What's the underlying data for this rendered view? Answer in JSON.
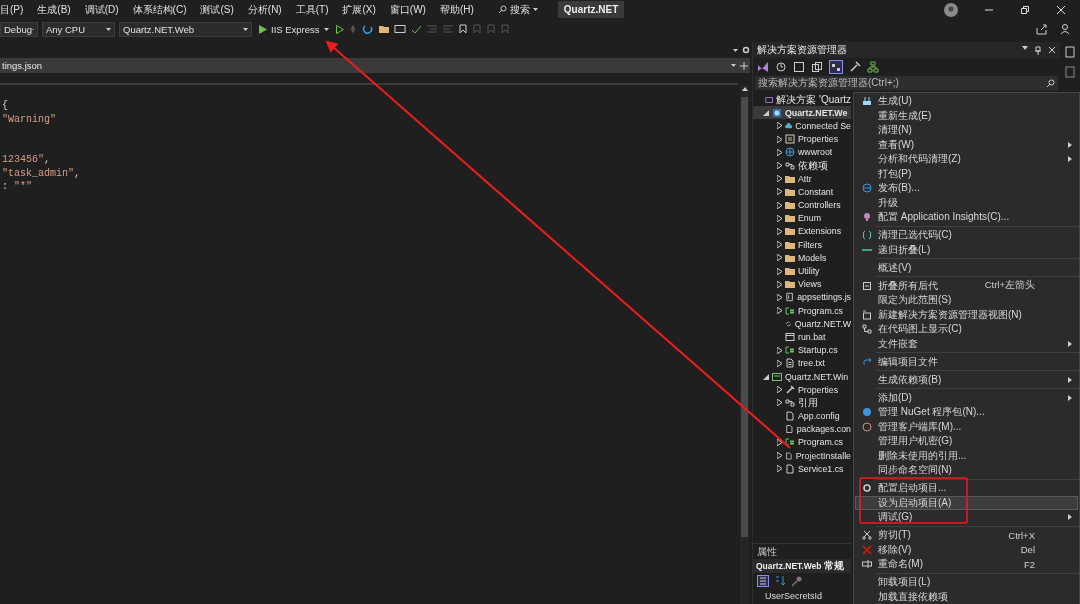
{
  "menu_bar": {
    "items": [
      "目(P)",
      "生成(B)",
      "调试(D)",
      "体系结构(C)",
      "测试(S)",
      "分析(N)",
      "工具(T)",
      "扩展(X)",
      "窗口(W)",
      "帮助(H)"
    ],
    "search": "搜索",
    "solution_name": "Quartz.NET"
  },
  "toolbar": {
    "configuration": "Debug",
    "platform": "Any CPU",
    "startup_project": "Quartz.NET.Web",
    "run_target": "IIS Express"
  },
  "editor": {
    "tab": {
      "title": "tings.json"
    },
    "lines": [
      {
        "kind": "code",
        "tokens": [
          {
            "kind": "punct",
            "text": "{"
          }
        ]
      },
      {
        "kind": "code",
        "tokens": [
          {
            "kind": "string",
            "text": "\"Warning\""
          }
        ]
      },
      {
        "kind": "blank"
      },
      {
        "kind": "blank"
      },
      {
        "kind": "code",
        "tokens": [
          {
            "kind": "string",
            "text": "123456\""
          },
          {
            "kind": "punct",
            "text": ","
          }
        ]
      },
      {
        "kind": "code",
        "tokens": [
          {
            "kind": "string",
            "text": "\"task_admin\""
          },
          {
            "kind": "punct",
            "text": ","
          }
        ]
      },
      {
        "kind": "code",
        "tokens": [
          {
            "kind": "punct",
            "text": ": "
          },
          {
            "kind": "string",
            "text": "\"*\""
          }
        ]
      }
    ]
  },
  "solution_explorer": {
    "title": "解决方案资源管理器",
    "search": {
      "placeholder": "搜索解决方案资源管理器(Ctrl+;)"
    },
    "tree": [
      {
        "label": "解决方案 'Quartz",
        "kind": "solution",
        "leaf": true,
        "selected": false,
        "children": [
          {
            "label": "Quartz.NET.We",
            "kind": "web-project",
            "leaf": false,
            "expanded": true,
            "selected": true,
            "children": [
              {
                "label": "Connected Se",
                "kind": "cloud",
                "leaf": false,
                "expanded": false,
                "selected": false
              },
              {
                "label": "Properties",
                "kind": "properties",
                "leaf": false,
                "expanded": false,
                "selected": false
              },
              {
                "label": "wwwroot",
                "kind": "globe",
                "leaf": false,
                "expanded": false,
                "selected": false
              },
              {
                "label": "依赖项",
                "kind": "dependencies",
                "leaf": false,
                "expanded": false,
                "selected": false
              },
              {
                "label": "Attr",
                "kind": "folder",
                "leaf": false,
                "expanded": false,
                "selected": false
              },
              {
                "label": "Constant",
                "kind": "folder",
                "leaf": false,
                "expanded": false,
                "selected": false
              },
              {
                "label": "Controllers",
                "kind": "folder",
                "leaf": false,
                "expanded": false,
                "selected": false
              },
              {
                "label": "Enum",
                "kind": "folder",
                "leaf": false,
                "expanded": false,
                "selected": false
              },
              {
                "label": "Extensions",
                "kind": "folder",
                "leaf": false,
                "expanded": false,
                "selected": false
              },
              {
                "label": "Filters",
                "kind": "folder",
                "leaf": false,
                "expanded": false,
                "selected": false
              },
              {
                "label": "Models",
                "kind": "folder",
                "leaf": false,
                "expanded": false,
                "selected": false
              },
              {
                "label": "Utility",
                "kind": "folder",
                "leaf": false,
                "expanded": false,
                "selected": false
              },
              {
                "label": "Views",
                "kind": "folder",
                "leaf": false,
                "expanded": false,
                "selected": false
              },
              {
                "label": "appsettings.js",
                "kind": "json",
                "leaf": false,
                "expanded": false,
                "selected": false
              },
              {
                "label": "Program.cs",
                "kind": "csharp",
                "leaf": false,
                "expanded": false,
                "selected": false
              },
              {
                "label": "Quartz.NET.W",
                "kind": "sync",
                "leaf": true,
                "selected": false
              },
              {
                "label": "run.bat",
                "kind": "batch",
                "leaf": true,
                "selected": false
              },
              {
                "label": "Startup.cs",
                "kind": "csharp",
                "leaf": false,
                "expanded": false,
                "selected": false
              },
              {
                "label": "tree.txt",
                "kind": "text",
                "leaf": false,
                "expanded": false,
                "selected": false
              }
            ]
          },
          {
            "label": "Quartz.NET.Win",
            "kind": "win-project",
            "leaf": false,
            "expanded": true,
            "selected": false,
            "children": [
              {
                "label": "Properties",
                "kind": "wrench",
                "leaf": false,
                "expanded": false,
                "selected": false
              },
              {
                "label": "引用",
                "kind": "dependencies",
                "leaf": false,
                "expanded": false,
                "selected": false
              },
              {
                "label": "App.config",
                "kind": "config",
                "leaf": true,
                "selected": false
              },
              {
                "label": "packages.con",
                "kind": "config",
                "leaf": true,
                "selected": false
              },
              {
                "label": "Program.cs",
                "kind": "csharp",
                "leaf": false,
                "expanded": false,
                "selected": false
              },
              {
                "label": "ProjectInstalle",
                "kind": "config",
                "leaf": false,
                "expanded": false,
                "selected": false
              },
              {
                "label": "Service1.cs",
                "kind": "config",
                "leaf": false,
                "expanded": false,
                "selected": false
              }
            ]
          }
        ]
      }
    ]
  },
  "properties": {
    "title": "属性",
    "object": "Quartz.NET.Web",
    "category": "常规",
    "rows": [
      {
        "name": "UserSecretsId"
      }
    ]
  },
  "context_menu": {
    "items": [
      {
        "kind": "item",
        "label": "生成(U)",
        "submenu": false,
        "selected": false
      },
      {
        "kind": "item",
        "label": "重新生成(E)",
        "submenu": false,
        "selected": false
      },
      {
        "kind": "item",
        "label": "清理(N)",
        "submenu": false,
        "selected": false
      },
      {
        "kind": "item",
        "label": "查看(W)",
        "submenu": true,
        "selected": false
      },
      {
        "kind": "item",
        "label": "分析和代码清理(Z)",
        "submenu": true,
        "selected": false
      },
      {
        "kind": "item",
        "label": "打包(P)",
        "submenu": false,
        "selected": false
      },
      {
        "kind": "item",
        "label": "发布(B)...",
        "submenu": false,
        "selected": false
      },
      {
        "kind": "item",
        "label": "升级",
        "submenu": false,
        "selected": false
      },
      {
        "kind": "item",
        "label": "配置 Application Insights(C)...",
        "submenu": false,
        "selected": false
      },
      {
        "kind": "separator"
      },
      {
        "kind": "item",
        "label": "清理已选代码(C)",
        "submenu": false,
        "selected": false
      },
      {
        "kind": "item",
        "label": "递归折叠(L)",
        "submenu": false,
        "selected": false
      },
      {
        "kind": "separator"
      },
      {
        "kind": "item",
        "label": "概述(V)",
        "submenu": false,
        "selected": false
      },
      {
        "kind": "separator"
      },
      {
        "kind": "item",
        "label": "折叠所有后代",
        "shortcut": "Ctrl+左箭头",
        "submenu": false,
        "selected": false
      },
      {
        "kind": "item",
        "label": "限定为此范围(S)",
        "submenu": false,
        "selected": false
      },
      {
        "kind": "item",
        "label": "新建解决方案资源管理器视图(N)",
        "submenu": false,
        "selected": false
      },
      {
        "kind": "item",
        "label": "在代码图上显示(C)",
        "submenu": false,
        "selected": false
      },
      {
        "kind": "item",
        "label": "文件嵌套",
        "submenu": true,
        "selected": false
      },
      {
        "kind": "separator"
      },
      {
        "kind": "item",
        "label": "编辑项目文件",
        "submenu": false,
        "selected": false
      },
      {
        "kind": "separator"
      },
      {
        "kind": "item",
        "label": "生成依赖项(B)",
        "submenu": true,
        "selected": false
      },
      {
        "kind": "separator"
      },
      {
        "kind": "item",
        "label": "添加(D)",
        "submenu": true,
        "selected": false
      },
      {
        "kind": "item",
        "label": "管理 NuGet 程序包(N)...",
        "submenu": false,
        "selected": false
      },
      {
        "kind": "item",
        "label": "管理客户端库(M)...",
        "submenu": false,
        "selected": false
      },
      {
        "kind": "item",
        "label": "管理用户机密(G)",
        "submenu": false,
        "selected": false
      },
      {
        "kind": "item",
        "label": "删除未使用的引用...",
        "submenu": false,
        "selected": false
      },
      {
        "kind": "item",
        "label": "同步命名空间(N)",
        "submenu": false,
        "selected": false
      },
      {
        "kind": "separator"
      },
      {
        "kind": "item",
        "label": "配置启动项目...",
        "submenu": false,
        "selected": false
      },
      {
        "kind": "item",
        "label": "设为启动项目(A)",
        "submenu": false,
        "selected": true
      },
      {
        "kind": "item",
        "label": "调试(G)",
        "submenu": true,
        "selected": false
      },
      {
        "kind": "separator"
      },
      {
        "kind": "item",
        "label": "剪切(T)",
        "shortcut": "Ctrl+X",
        "submenu": false,
        "selected": false
      },
      {
        "kind": "item",
        "label": "移除(V)",
        "shortcut": "Del",
        "submenu": false,
        "selected": false
      },
      {
        "kind": "item",
        "label": "重命名(M)",
        "shortcut": "F2",
        "submenu": false,
        "selected": false
      },
      {
        "kind": "separator"
      },
      {
        "kind": "item",
        "label": "卸载项目(L)",
        "submenu": false,
        "selected": false
      },
      {
        "kind": "item",
        "label": "加载直接依赖项",
        "submenu": false,
        "selected": false
      }
    ]
  }
}
